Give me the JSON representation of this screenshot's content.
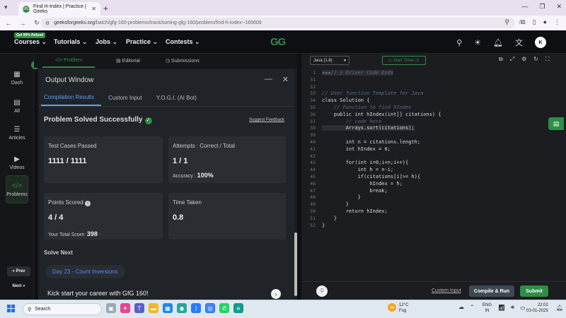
{
  "browser": {
    "tab_title": "Find H-Index | Practice | Geeks",
    "tab_favicon": "GfG",
    "url_host": "geeksforgeeks.org",
    "url_path": "/batch/gfg-160-problems/track/sorting-gfg-160/problem/find-h-index--165609"
  },
  "nav": {
    "badge": "Get 90% Refund",
    "items": [
      "Courses ⌄",
      "Tutorials ⌄",
      "Jobs ⌄",
      "Practice ⌄",
      "Contests ⌄"
    ],
    "logo": "GG",
    "avatar": "K"
  },
  "sidebar": {
    "items": [
      {
        "label": "Dash",
        "icon": "▦"
      },
      {
        "label": "All",
        "icon": "▤"
      },
      {
        "label": "Articles",
        "icon": "☰"
      },
      {
        "label": "Videos",
        "icon": "▶"
      },
      {
        "label": "Problems",
        "icon": "</>"
      }
    ],
    "prev": "« Prev",
    "next": "Next »"
  },
  "problem_tabs": [
    "</> Problem",
    "▤ Editorial",
    "◷ Submissions"
  ],
  "output": {
    "title": "Output Window",
    "tabs": [
      "Compilation Results",
      "Custom Input",
      "Y.O.G.I. (AI Bot)"
    ],
    "status": "Problem Solved Successfully",
    "suggest": "Suggest Feedback",
    "cards": {
      "tests_label": "Test Cases Passed",
      "tests_value": "1111 / 1111",
      "attempts_label": "Attempts : Correct / Total",
      "attempts_value": "1 / 1",
      "accuracy_label": "Accuracy : ",
      "accuracy_value": "100%",
      "points_label": "Points Scored",
      "points_value": "4 / 4",
      "score_label": "Your Total Score: ",
      "score_value": "398",
      "time_label": "Time Taken",
      "time_value": "0.8"
    },
    "solve_next": "Solve Next",
    "next_problem": "Day 23 - Count Inversions",
    "kickstart": "Kick start your career with GfG 160!"
  },
  "editor": {
    "language": "Java (1.8)",
    "timer": "▷ Start Timer ◷",
    "lines": [
      {
        "n": "1",
        "code": "▪▪▪// } Driver Code Ends",
        "type": "cm",
        "hl": true
      },
      {
        "n": "31",
        "code": "",
        "type": ""
      },
      {
        "n": "32",
        "code": "",
        "type": ""
      },
      {
        "n": "33",
        "code": "// User function Template for Java",
        "type": "cm"
      },
      {
        "n": "34",
        "code": "class Solution {",
        "type": ""
      },
      {
        "n": "35",
        "code": "    // Function to find hIndex",
        "type": "cm"
      },
      {
        "n": "36",
        "code": "    public int hIndex(int[] citations) {",
        "type": ""
      },
      {
        "n": "37",
        "code": "        // code here",
        "type": "cm"
      },
      {
        "n": "38",
        "code": "        Arrays.sort(citations);",
        "type": "",
        "hl": true
      },
      {
        "n": "39",
        "code": "",
        "type": ""
      },
      {
        "n": "40",
        "code": "        int n = citations.length;",
        "type": ""
      },
      {
        "n": "41",
        "code": "        int hIndex = 0;",
        "type": ""
      },
      {
        "n": "42",
        "code": "",
        "type": ""
      },
      {
        "n": "43",
        "code": "        for(int i=0;i<n;i++){",
        "type": ""
      },
      {
        "n": "44",
        "code": "            int h = n-i;",
        "type": ""
      },
      {
        "n": "45",
        "code": "            if(citations[i]>= h){",
        "type": ""
      },
      {
        "n": "46",
        "code": "                hIndex = h;",
        "type": ""
      },
      {
        "n": "47",
        "code": "                break;",
        "type": ""
      },
      {
        "n": "48",
        "code": "            }",
        "type": ""
      },
      {
        "n": "49",
        "code": "        }",
        "type": ""
      },
      {
        "n": "50",
        "code": "        return hIndex;",
        "type": ""
      },
      {
        "n": "51",
        "code": "    }",
        "type": ""
      },
      {
        "n": "52",
        "code": "}",
        "type": ""
      }
    ],
    "custom_input": "Custom Input",
    "compile_run": "Compile & Run",
    "submit": "Submit"
  },
  "taskbar": {
    "search": "Search",
    "weather_temp": "12°C",
    "weather_desc": "Fog",
    "lang_line1": "ENG",
    "lang_line2": "IN",
    "time": "22:02",
    "date": "03-01-2025"
  },
  "colors": {
    "brand_green": "#2f8d46",
    "accent_blue": "#58a0ff"
  }
}
